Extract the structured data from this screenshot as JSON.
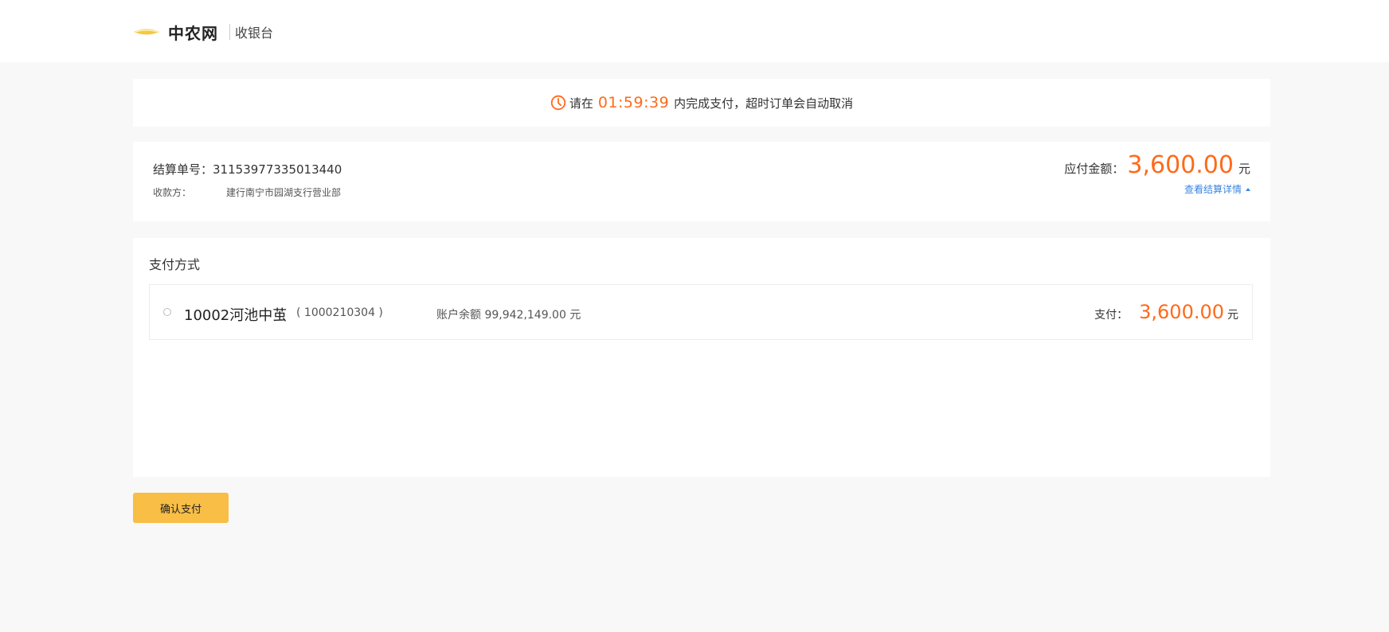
{
  "header": {
    "brand": "中农网",
    "subtitle": "收银台"
  },
  "timer": {
    "prefix": "请在",
    "time": "01:59:39",
    "suffix": "内完成支付，超时订单会自动取消"
  },
  "order": {
    "number_label": "结算单号：",
    "number": "31153977335013440",
    "payee_label": "收款方：",
    "payee": "建行南宁市园湖支行营业部",
    "amount_label": "应付金额：",
    "amount": "3,600.00",
    "unit": "元",
    "detail_link": "查看结算详情"
  },
  "payment": {
    "title": "支付方式",
    "methods": [
      {
        "name": "10002河池中茧",
        "account": "( 1000210304 )",
        "balance_label": "账户余额",
        "balance": "99,942,149.00",
        "balance_unit": "元",
        "pay_label": "支付：",
        "pay_amount": "3,600.00",
        "pay_unit": "元"
      }
    ]
  },
  "confirm_label": "确认支付",
  "colors": {
    "accent": "#ff6a1a",
    "button": "#f8be45",
    "link": "#3a84e0"
  }
}
